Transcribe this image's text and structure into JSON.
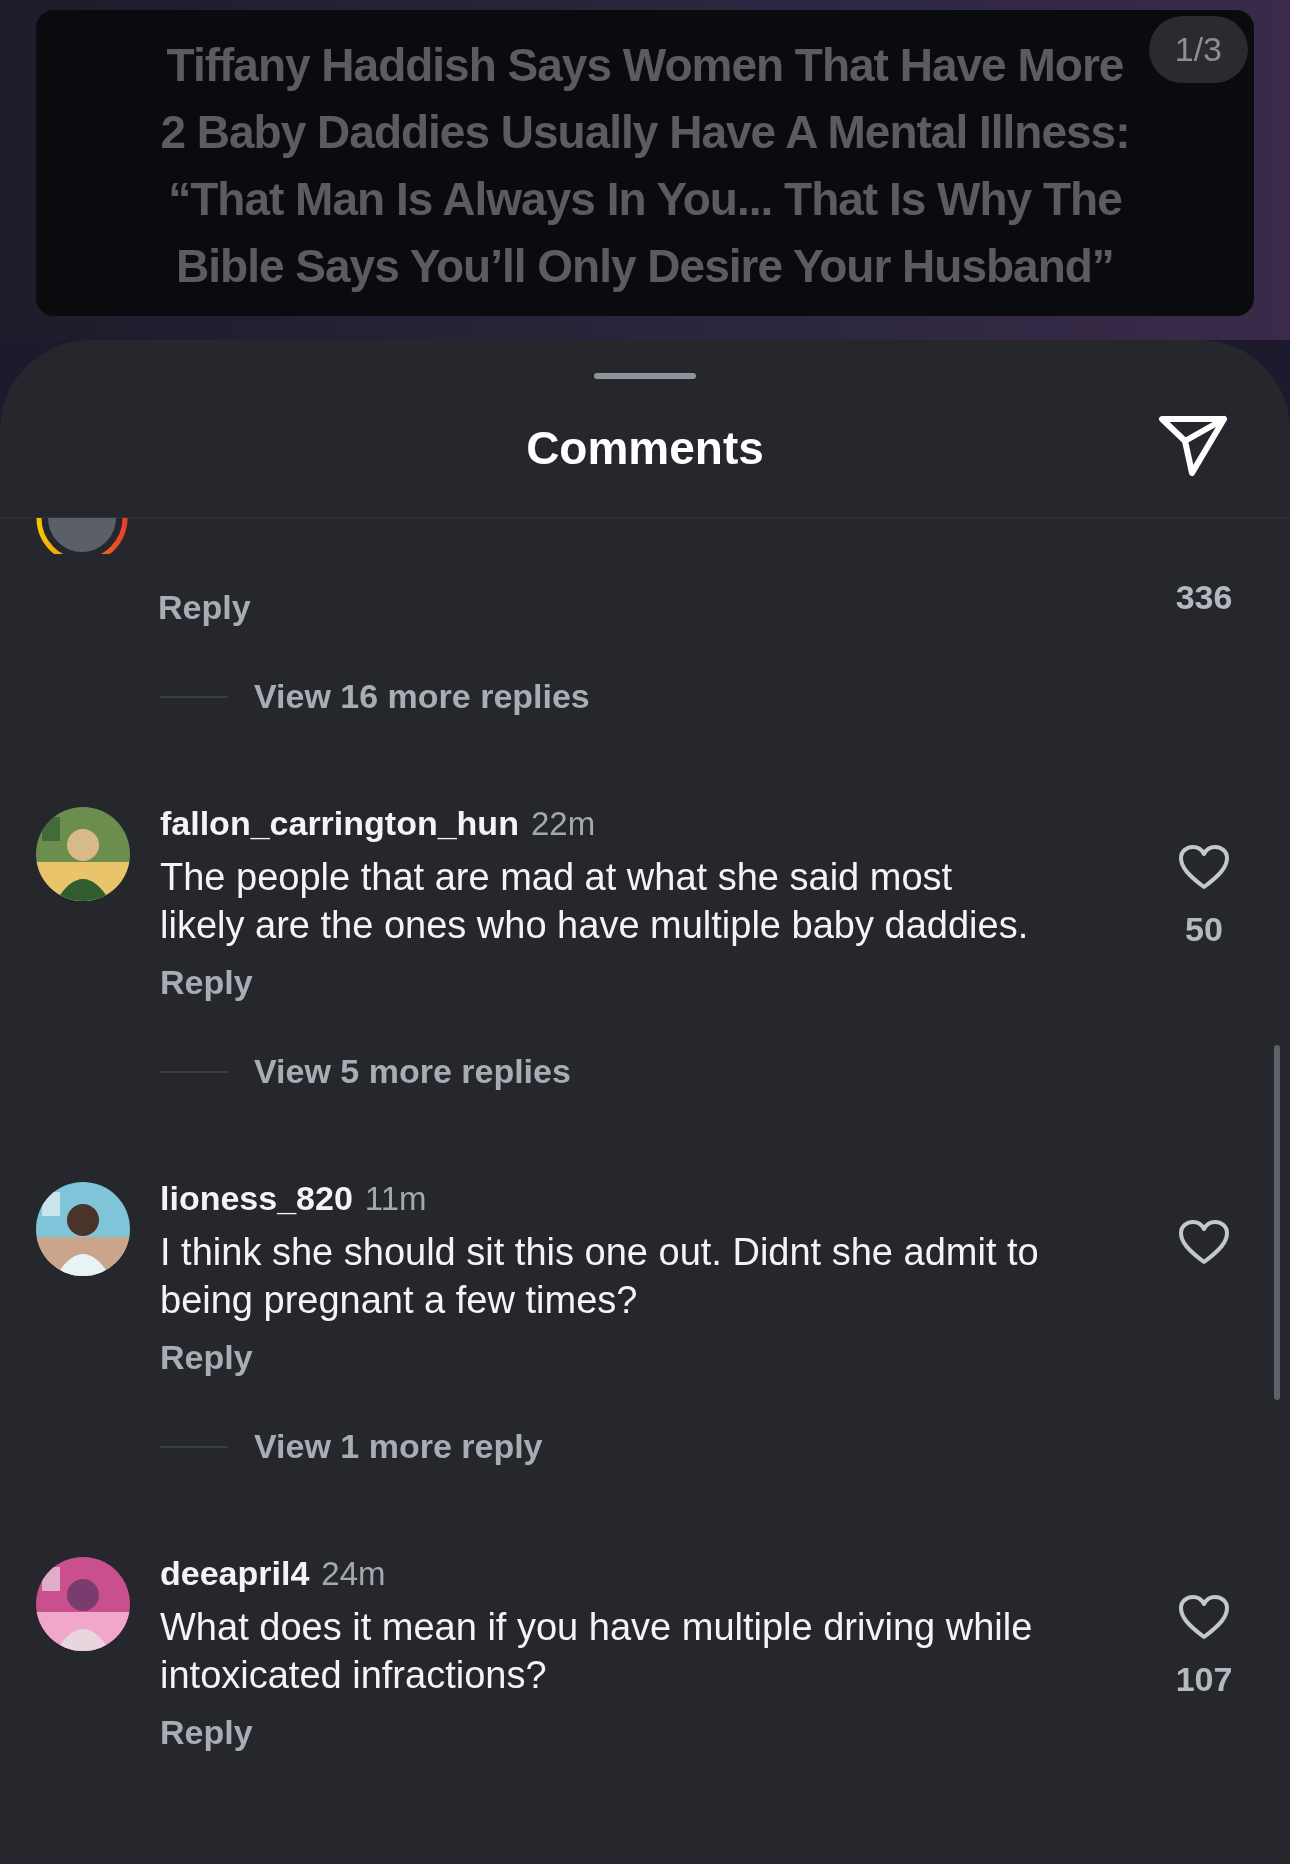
{
  "post": {
    "caption_lines": [
      "Tiffany Haddish Says Women That Have More",
      "2 Baby Daddies Usually Have A Mental Illness:",
      "“That Man Is Always In You...  That Is Why The",
      "Bible Says You’ll Only Desire Your Husband”"
    ],
    "page_indicator": "1/3"
  },
  "sheet": {
    "title": "Comments"
  },
  "comments": [
    {
      "kind": "clipped",
      "reply_label": "Reply",
      "likes": "336",
      "more_replies": "View 16 more replies"
    },
    {
      "kind": "full",
      "username": "fallon_carrington_hun",
      "time": "22m",
      "text": "The people that are mad at what she said most likely are the ones who have multiple baby daddies.",
      "reply_label": "Reply",
      "likes": "50",
      "more_replies": "View 5 more replies"
    },
    {
      "kind": "full",
      "username": "lioness_820",
      "time": "11m",
      "text": "I think she should sit this one out. Didnt she admit to being pregnant a few times?",
      "reply_label": "Reply",
      "more_replies": "View 1 more reply"
    },
    {
      "kind": "full",
      "username": "deeapril4",
      "time": "24m",
      "text": "What does it mean if you have multiple driving while intoxicated infractions?",
      "reply_label": "Reply",
      "likes": "107"
    }
  ]
}
